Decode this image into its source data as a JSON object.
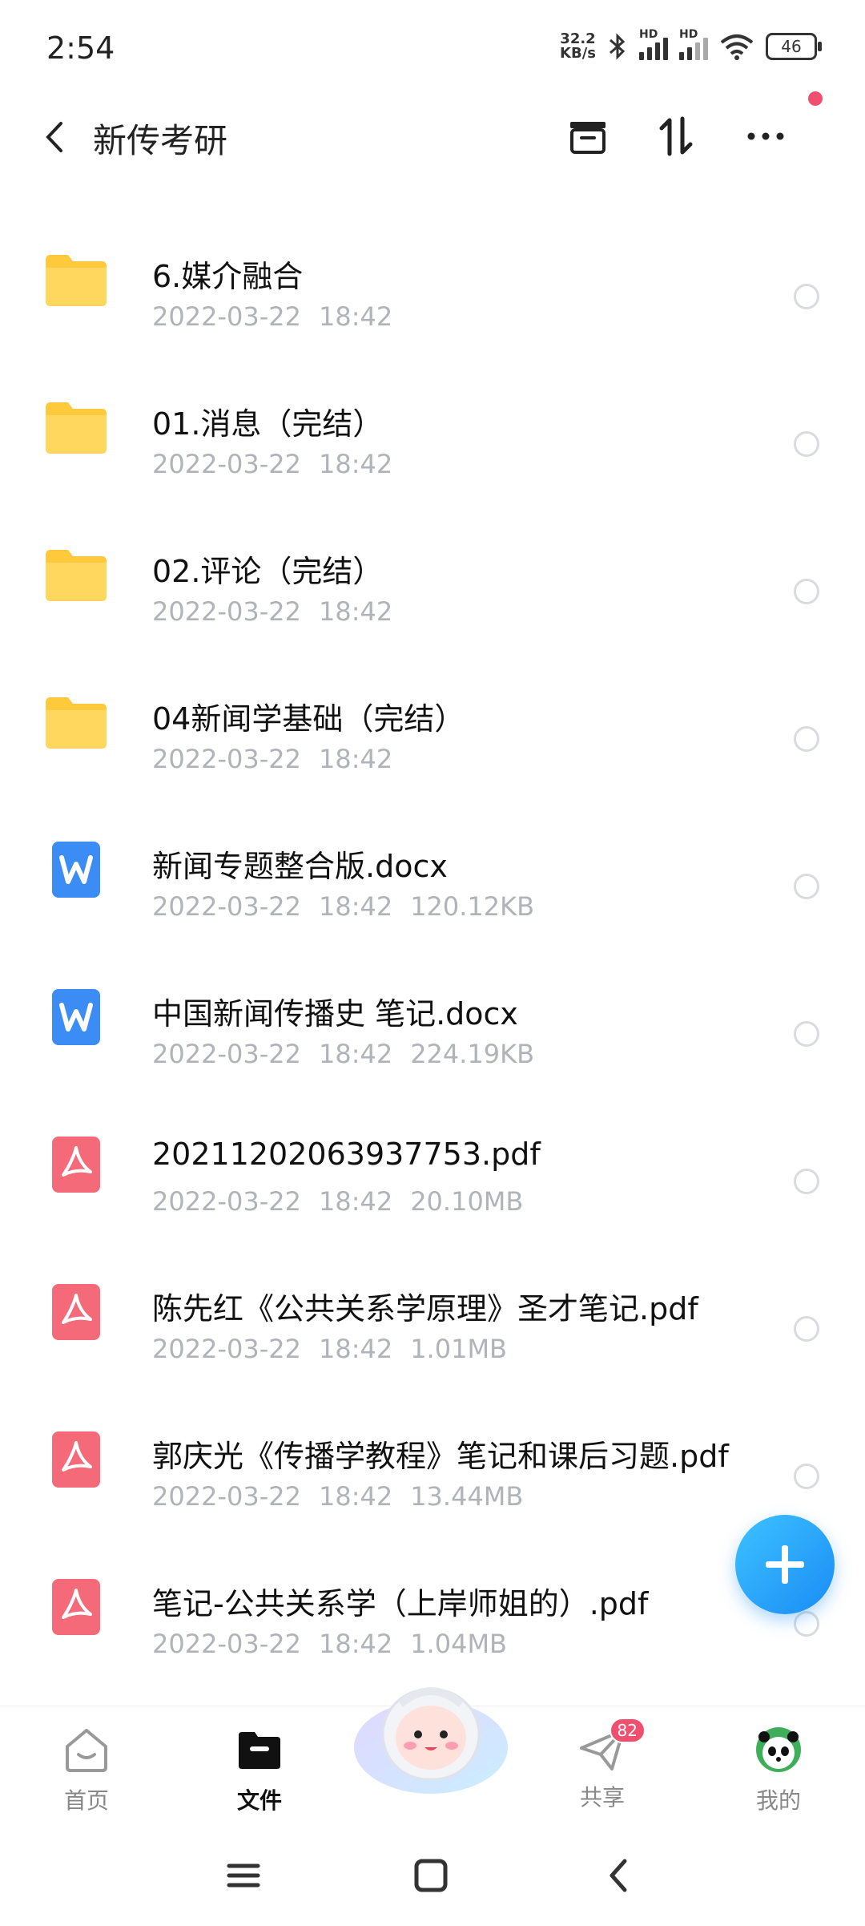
{
  "status_bar": {
    "time": "2:54",
    "net_speed_value": "32.2",
    "net_speed_unit": "KB/s",
    "signal_label": "HD",
    "battery": "46"
  },
  "header": {
    "title": "新传考研"
  },
  "files": [
    {
      "type": "folder",
      "name": "6.媒介融合",
      "date": "2022-03-22",
      "time": "18:42",
      "size": ""
    },
    {
      "type": "folder",
      "name": "01.消息（完结）",
      "date": "2022-03-22",
      "time": "18:42",
      "size": ""
    },
    {
      "type": "folder",
      "name": "02.评论（完结）",
      "date": "2022-03-22",
      "time": "18:42",
      "size": ""
    },
    {
      "type": "folder",
      "name": "04新闻学基础（完结）",
      "date": "2022-03-22",
      "time": "18:42",
      "size": ""
    },
    {
      "type": "word",
      "name": "新闻专题整合版.docx",
      "date": "2022-03-22",
      "time": "18:42",
      "size": "120.12KB"
    },
    {
      "type": "word",
      "name": "中国新闻传播史 笔记.docx",
      "date": "2022-03-22",
      "time": "18:42",
      "size": "224.19KB"
    },
    {
      "type": "pdf",
      "name": "20211202063937753.pdf",
      "date": "2022-03-22",
      "time": "18:42",
      "size": "20.10MB"
    },
    {
      "type": "pdf",
      "name": "陈先红《公共关系学原理》圣才笔记.pdf",
      "date": "2022-03-22",
      "time": "18:42",
      "size": "1.01MB"
    },
    {
      "type": "pdf",
      "name": "郭庆光《传播学教程》笔记和课后习题.pdf",
      "date": "2022-03-22",
      "time": "18:42",
      "size": "13.44MB"
    },
    {
      "type": "pdf",
      "name": "笔记-公共关系学（上岸师姐的）.pdf",
      "date": "2022-03-22",
      "time": "18:42",
      "size": "1.04MB"
    }
  ],
  "bottom_nav": {
    "home": "首页",
    "files": "文件",
    "share": "共享",
    "share_badge": "82",
    "mine": "我的"
  },
  "colors": {
    "folder": "#ffc93c",
    "word": "#3b8cf5",
    "pdf": "#f46a78",
    "accent": "#1f93f7",
    "badge": "#f0506e"
  }
}
